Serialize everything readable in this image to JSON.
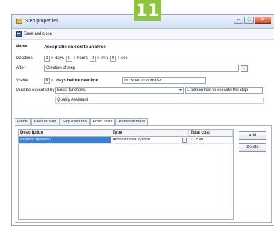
{
  "badge": {
    "number": "11",
    "color": "#8cc63f"
  },
  "window": {
    "title": "Step properties",
    "controls": {
      "minimize": "–",
      "maximize": "□",
      "close": "✕"
    }
  },
  "toolbar": {
    "save_close_label": "Save and close"
  },
  "form": {
    "name": {
      "label": "Name",
      "value": "Acceptatie en eerste analyse"
    },
    "deadline": {
      "label": "Deadline",
      "days": "2",
      "days_unit": "days",
      "hours": "0",
      "hours_unit": "hours",
      "min": "0",
      "min_unit": "min",
      "sec": "0",
      "sec_unit": "sec"
    },
    "after": {
      "label": "After",
      "value": "Creation of step"
    },
    "visible": {
      "label": "Visible",
      "days": "0",
      "suffix": "days before deadline",
      "dropdown_value": "no when to consider"
    },
    "executed_by": {
      "label": "Must be executed by",
      "dropdown_value": "Entail functions",
      "rule_value": "1 person has to execute the step",
      "person": "Quality Assistant"
    }
  },
  "tabs": [
    {
      "label": "Fields"
    },
    {
      "label": "Execute step"
    },
    {
      "label": "Step executed"
    },
    {
      "label": "Fixed costs"
    },
    {
      "label": "Reminder mails"
    }
  ],
  "grid": {
    "columns": [
      "Description",
      "Type",
      "Total cost"
    ],
    "rows": [
      {
        "description": "Analyse operation",
        "type": "Administrative system",
        "total": "€ 75.00"
      }
    ]
  },
  "buttons": {
    "add": "Add",
    "delete": "Delete"
  },
  "colors": {
    "selection": "#3f7fd1",
    "titlebar": "#d3e1f3"
  }
}
